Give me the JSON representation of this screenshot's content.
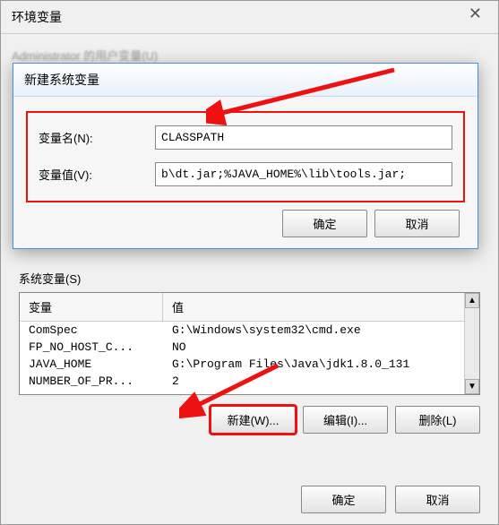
{
  "parent": {
    "title": "环境变量",
    "blurred_header": "Administrator 的用户变量(U)"
  },
  "dialog": {
    "title": "新建系统变量",
    "name_label": "变量名(N):",
    "value_label": "变量值(V):",
    "name_input": "CLASSPATH",
    "value_input": "b\\dt.jar;%JAVA_HOME%\\lib\\tools.jar;",
    "ok": "确定",
    "cancel": "取消"
  },
  "sysvars": {
    "label": "系统变量(S)",
    "col_name": "变量",
    "col_value": "值",
    "rows": [
      {
        "name": "ComSpec",
        "value": "G:\\Windows\\system32\\cmd.exe"
      },
      {
        "name": "FP_NO_HOST_C...",
        "value": "NO"
      },
      {
        "name": "JAVA_HOME",
        "value": "G:\\Program Files\\Java\\jdk1.8.0_131"
      },
      {
        "name": "NUMBER_OF_PR...",
        "value": "2"
      }
    ],
    "new_btn": "新建(W)...",
    "edit_btn": "编辑(I)...",
    "delete_btn": "删除(L)"
  },
  "bottom": {
    "ok": "确定",
    "cancel": "取消"
  },
  "annotation": {
    "color": "#e11"
  }
}
